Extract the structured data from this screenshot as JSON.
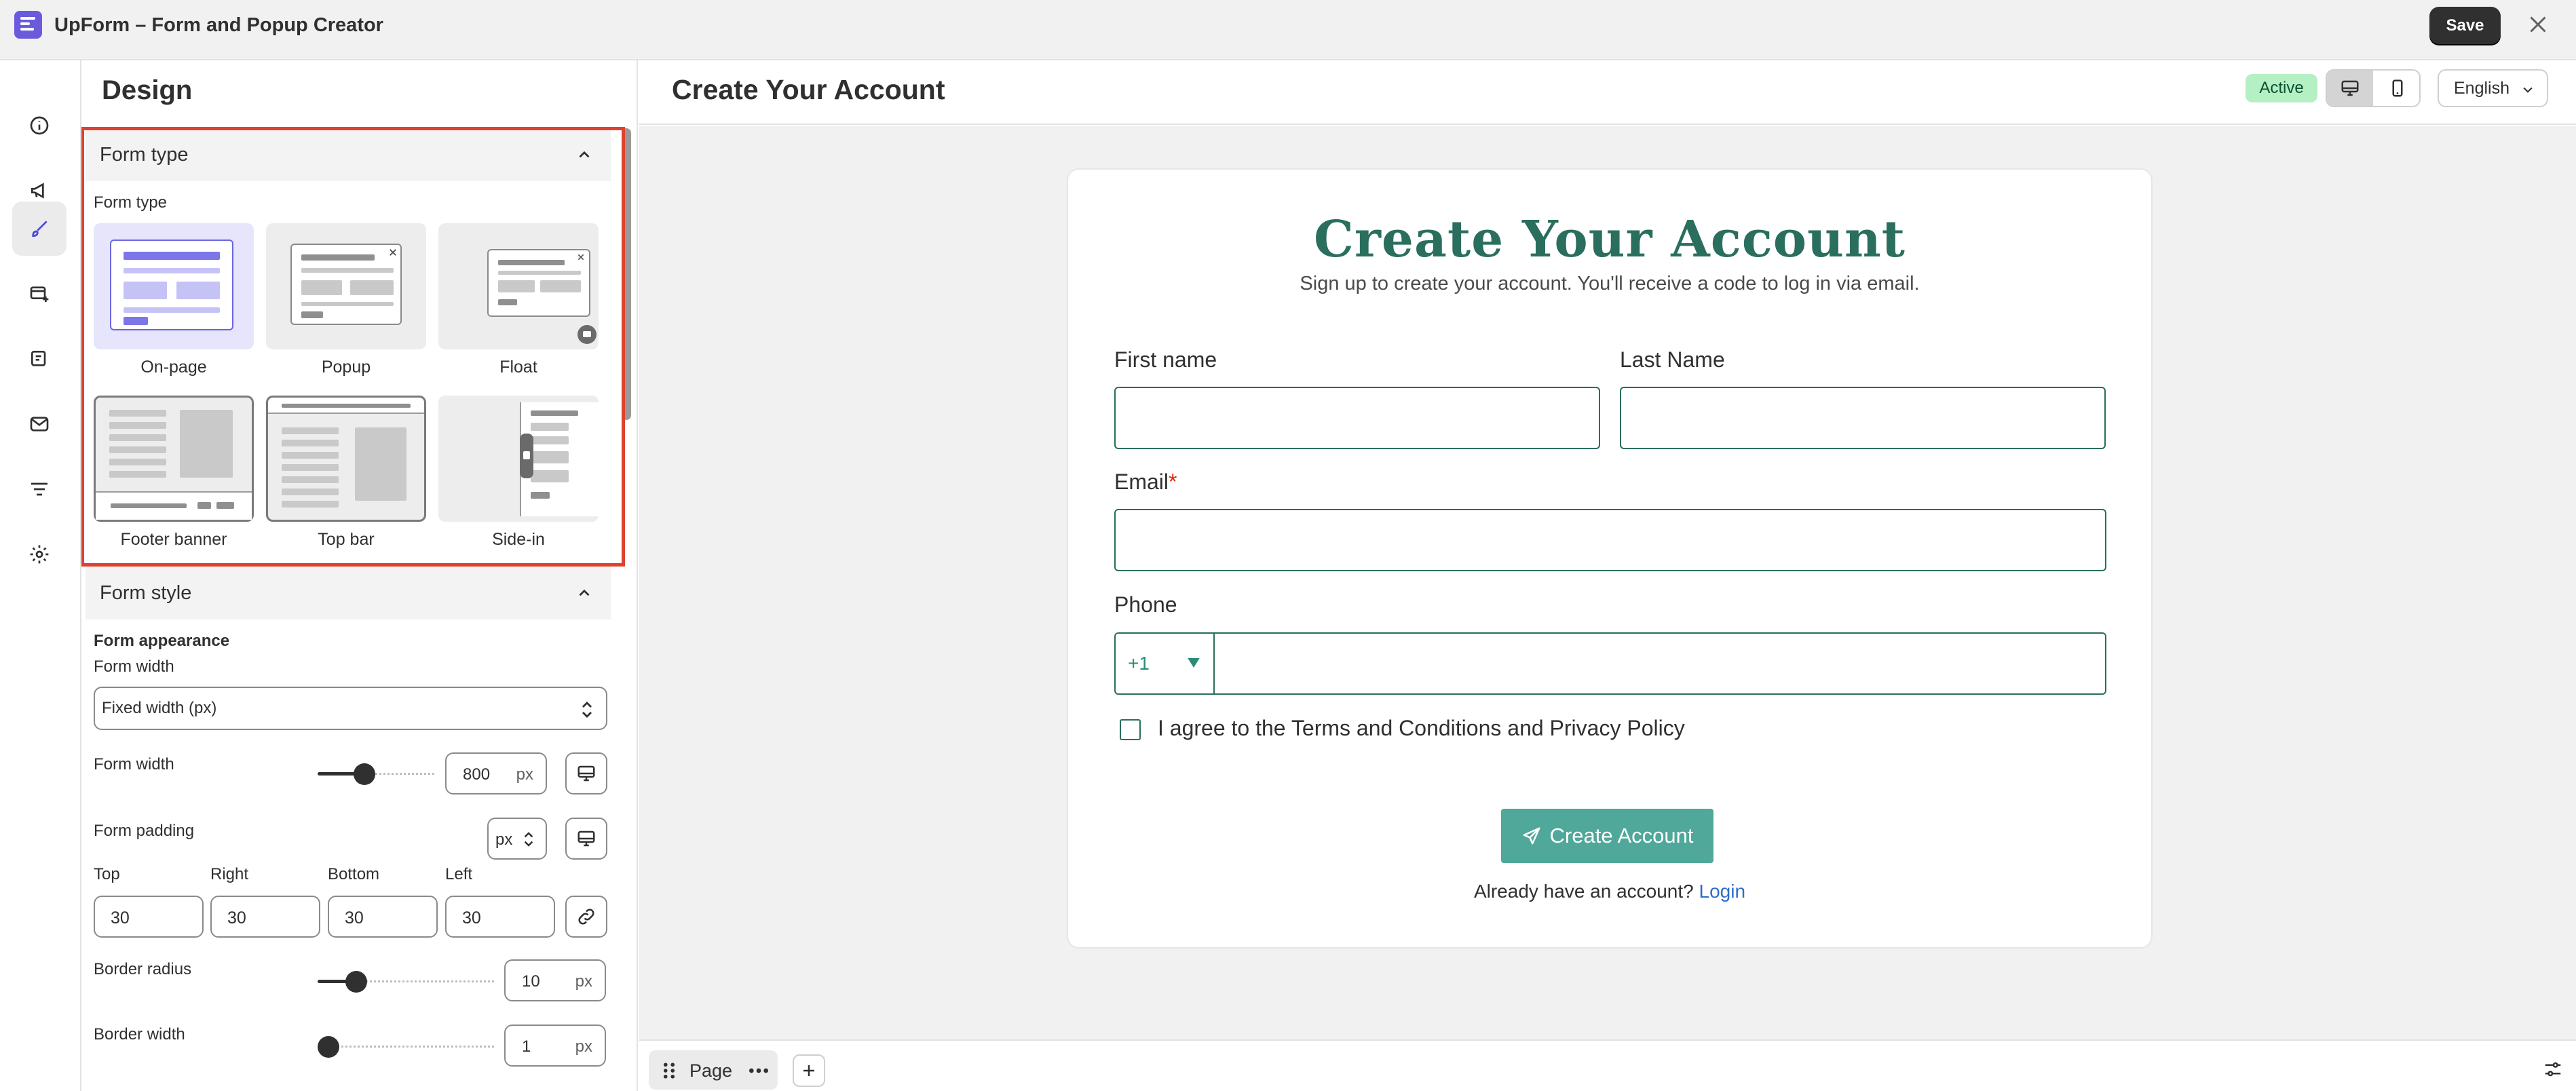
{
  "app": {
    "title": "UpForm – Form and Popup Creator",
    "save_label": "Save"
  },
  "rail": {
    "items": [
      {
        "icon": "info-icon"
      },
      {
        "icon": "megaphone-icon"
      },
      {
        "icon": "paintbrush-icon",
        "active": true
      },
      {
        "icon": "form-add-icon"
      },
      {
        "icon": "notification-icon"
      },
      {
        "icon": "email-icon"
      },
      {
        "icon": "filter-icon"
      },
      {
        "icon": "gear-icon"
      }
    ]
  },
  "panel": {
    "title": "Design",
    "form_type_section": {
      "header": "Form type",
      "label": "Form type",
      "options": [
        {
          "label": "On-page",
          "selected": true
        },
        {
          "label": "Popup"
        },
        {
          "label": "Float"
        },
        {
          "label": "Footer banner"
        },
        {
          "label": "Top bar"
        },
        {
          "label": "Side-in"
        }
      ]
    },
    "form_style_section": {
      "header": "Form style",
      "appearance_label": "Form appearance",
      "width_mode_label": "Form width",
      "width_mode_value": "Fixed width (px)",
      "form_width": {
        "label": "Form width",
        "value": "800",
        "unit": "px",
        "slider_fraction": 0.4
      },
      "form_padding": {
        "label": "Form padding",
        "unit": "px",
        "fields": [
          {
            "label": "Top",
            "value": "30"
          },
          {
            "label": "Right",
            "value": "30"
          },
          {
            "label": "Bottom",
            "value": "30"
          },
          {
            "label": "Left",
            "value": "30"
          }
        ]
      },
      "border_radius": {
        "label": "Border radius",
        "value": "10",
        "unit": "px",
        "slider_fraction": 0.22
      },
      "border_width": {
        "label": "Border width",
        "value": "1",
        "unit": "px",
        "slider_fraction": 0.06
      }
    }
  },
  "main": {
    "title": "Create Your Account",
    "status": "Active",
    "language": "English"
  },
  "form": {
    "title": "Create Your Account",
    "subtitle": "Sign up to create your account. You'll receive a code to log in via email.",
    "first_name_label": "First name",
    "last_name_label": "Last Name",
    "email_label": "Email",
    "required_mark": "*",
    "phone_label": "Phone",
    "country_code": "+1",
    "consent": "I agree to the Terms and Conditions and Privacy Policy",
    "submit_label": "Create Account",
    "login_prompt": "Already have an account?",
    "login_link": "Login",
    "accent_color": "#2a6e5e",
    "button_color": "#4fa89a"
  },
  "bottom": {
    "page_tab": "Page"
  }
}
